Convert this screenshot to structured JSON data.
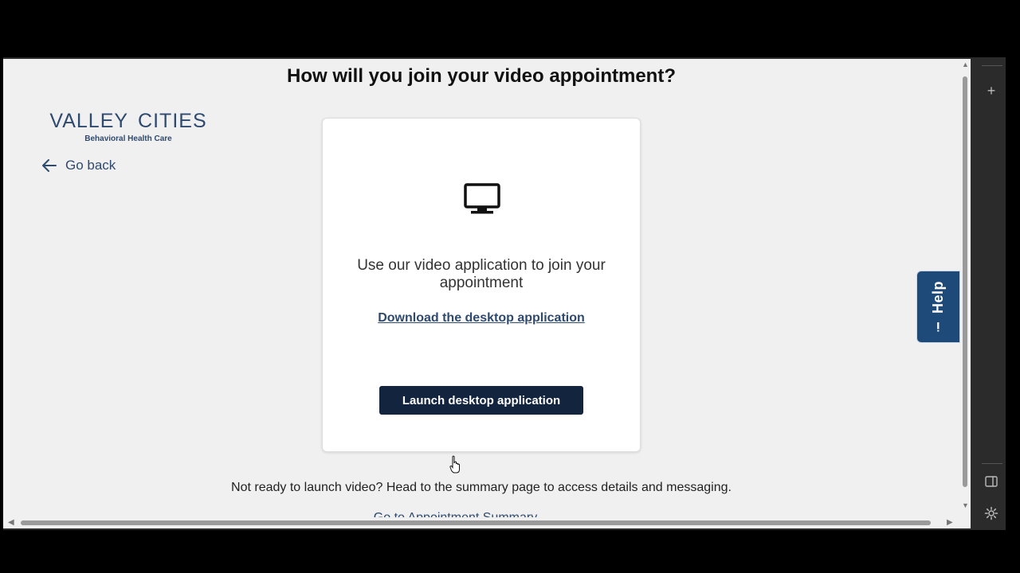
{
  "page": {
    "title": "How will you join your video appointment?"
  },
  "logo": {
    "name_left": "VALLEY",
    "name_right": "CITIES",
    "tagline": "Behavioral Health Care"
  },
  "nav": {
    "go_back_label": "Go back"
  },
  "card": {
    "icon": "desktop-monitor-icon",
    "description": "Use our video application to join your appointment",
    "download_link": "Download the desktop application",
    "launch_button": "Launch desktop application"
  },
  "footer": {
    "not_ready_text": "Not ready to launch video? Head to the summary page to access details and messaging.",
    "cut_link": "Go to Appointment Summary"
  },
  "help": {
    "label": "Help",
    "icon": "info-icon"
  },
  "colors": {
    "brand": "#2f4a6e",
    "accent": "#e8b638",
    "button": "#13243f",
    "help_tab": "#1e4a7a"
  }
}
